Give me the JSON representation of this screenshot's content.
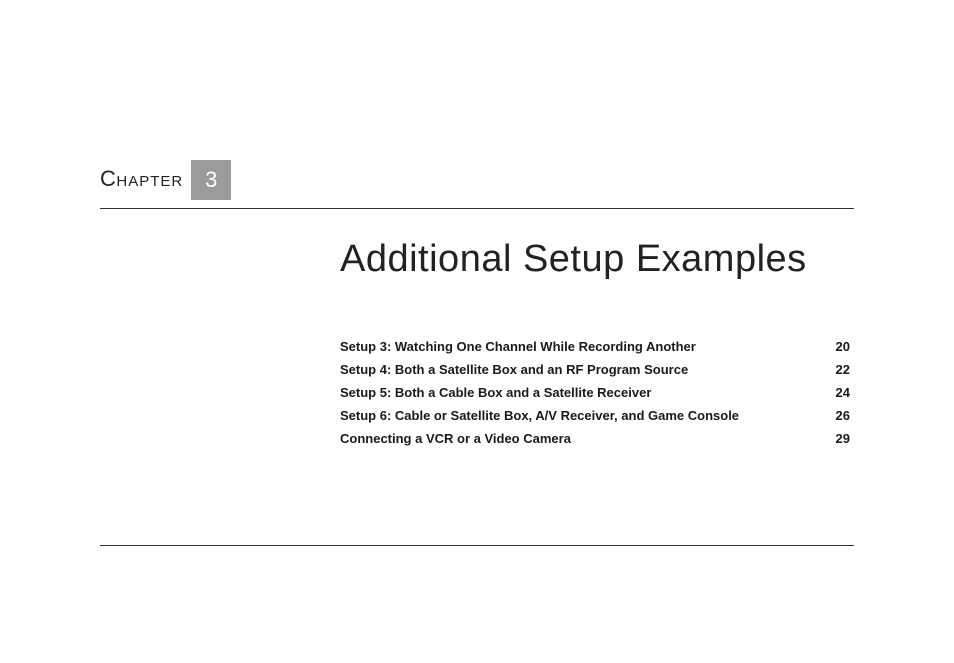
{
  "chapter": {
    "label_text": "Chapter",
    "number": "3"
  },
  "title": "Additional Setup Examples",
  "toc": [
    {
      "label": "Setup 3: Watching One Channel While Recording Another",
      "page": "20"
    },
    {
      "label": "Setup 4: Both a Satellite Box and an RF Program Source",
      "page": "22"
    },
    {
      "label": "Setup 5: Both a Cable Box and a Satellite Receiver",
      "page": "24"
    },
    {
      "label": "Setup 6: Cable or Satellite Box, A/V Receiver, and Game Console",
      "page": "26"
    },
    {
      "label": "Connecting a VCR or a Video Camera",
      "page": "29"
    }
  ]
}
